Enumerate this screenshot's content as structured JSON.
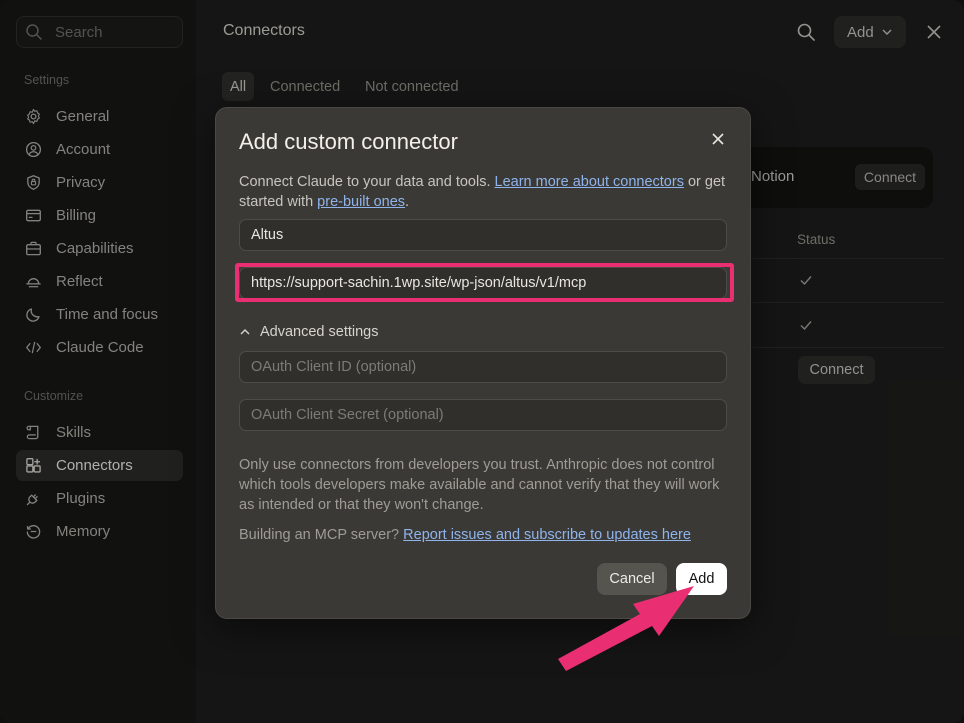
{
  "sidebar": {
    "search_placeholder": "Search",
    "settings_label": "Settings",
    "settings_items": [
      {
        "label": "General",
        "icon": "gear-icon"
      },
      {
        "label": "Account",
        "icon": "user-circle-icon"
      },
      {
        "label": "Privacy",
        "icon": "shield-icon"
      },
      {
        "label": "Billing",
        "icon": "credit-card-icon"
      },
      {
        "label": "Capabilities",
        "icon": "briefcase-icon"
      },
      {
        "label": "Reflect",
        "icon": "sunrise-icon"
      },
      {
        "label": "Time and focus",
        "icon": "moon-icon"
      },
      {
        "label": "Claude Code",
        "icon": "code-icon"
      }
    ],
    "customize_label": "Customize",
    "customize_items": [
      {
        "label": "Skills",
        "icon": "scroll-icon"
      },
      {
        "label": "Connectors",
        "icon": "grid-plus-icon",
        "active": true
      },
      {
        "label": "Plugins",
        "icon": "plug-icon"
      },
      {
        "label": "Memory",
        "icon": "history-icon"
      }
    ]
  },
  "header": {
    "title": "Connectors",
    "add_label": "Add"
  },
  "tabs": [
    "All",
    "Connected",
    "Not connected"
  ],
  "background": {
    "card_name": "Notion",
    "card_button": "Connect",
    "status_header": "Status",
    "row_button": "Connect"
  },
  "modal": {
    "title": "Add custom connector",
    "desc_prefix": "Connect Claude to your data and tools. ",
    "desc_link1": "Learn more about connectors",
    "desc_mid": " or get started with ",
    "desc_link2": "pre-built ones",
    "desc_suffix": ".",
    "name_value": "Altus",
    "url_value": "https://support-sachin.1wp.site/wp-json/altus/v1/mcp",
    "advanced_label": "Advanced settings",
    "client_id_placeholder": "OAuth Client ID (optional)",
    "client_secret_placeholder": "OAuth Client Secret (optional)",
    "notice": "Only use connectors from developers you trust. Anthropic does not control which tools developers make available and cannot verify that they will work as intended or that they won't change.",
    "footer_prefix": "Building an MCP server? ",
    "footer_link": "Report issues and subscribe to updates here",
    "cancel_label": "Cancel",
    "add_label": "Add"
  },
  "colors": {
    "highlight": "#ea2e72",
    "link": "#8fb4ec",
    "modal_bg": "#3a3935"
  }
}
